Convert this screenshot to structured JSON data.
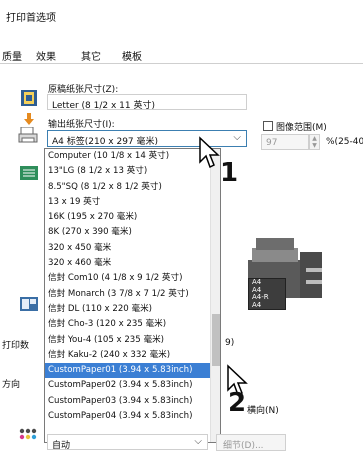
{
  "window": {
    "title": "打印首选项"
  },
  "tabs": [
    "质量",
    "效果",
    "其它",
    "模板"
  ],
  "original_paper": {
    "label": "原稿纸张尺寸(Z):",
    "value": "Letter (8 1/2 x 11 英寸)"
  },
  "output_paper": {
    "label": "输出纸张尺寸(I):",
    "value": "A4 标签(210 x 297 毫米)"
  },
  "image_area": {
    "label": "图像范围(M)",
    "value": "97",
    "unit": "%(25-400)"
  },
  "dropdown_items": [
    "Computer (10 1/8 x 14 英寸)",
    "13\"LG (8 1/2 x 13 英寸)",
    "8.5\"SQ (8 1/2 x 8 1/2 英寸)",
    "13 x 19 英寸",
    "16K (195 x 270 毫米)",
    "8K (270 x 390 毫米)",
    "320 x 450 毫米",
    "320 x 460 毫米",
    "信封 Com10 (4 1/8 x 9 1/2 英寸)",
    "信封 Monarch (3 7/8 x 7 1/2 英寸)",
    "信封 DL (110 x 220 毫米)",
    "信封 Cho-3 (120 x 235 毫米)",
    "信封 You-4 (105 x 235 毫米)",
    "信封 Kaku-2 (240 x 332 毫米)",
    "CustomPaper01 (3.94 x 5.83inch)",
    "CustomPaper02 (3.94 x 5.83inch)",
    "CustomPaper03 (3.94 x 5.83inch)",
    "CustomPaper04 (3.94 x 5.83inch)"
  ],
  "highlighted_index": 14,
  "print_count_label": "打印数",
  "print_count_value": "9)",
  "orientation_label": "方向",
  "landscape_label": "横向(N)",
  "paper_boxes": [
    "A4",
    "A4",
    "A4-R",
    "A4"
  ],
  "bottom_select": {
    "value": "自动"
  },
  "details_button": {
    "label": "细节(D)..."
  },
  "callouts": [
    "1",
    "2"
  ],
  "icons": {
    "original": "document-icon",
    "output": "print-output-icon",
    "printer": "printer-icon",
    "copies": "copies-icon",
    "orientation": "orientation-icon",
    "color": "color-dots-icon"
  }
}
